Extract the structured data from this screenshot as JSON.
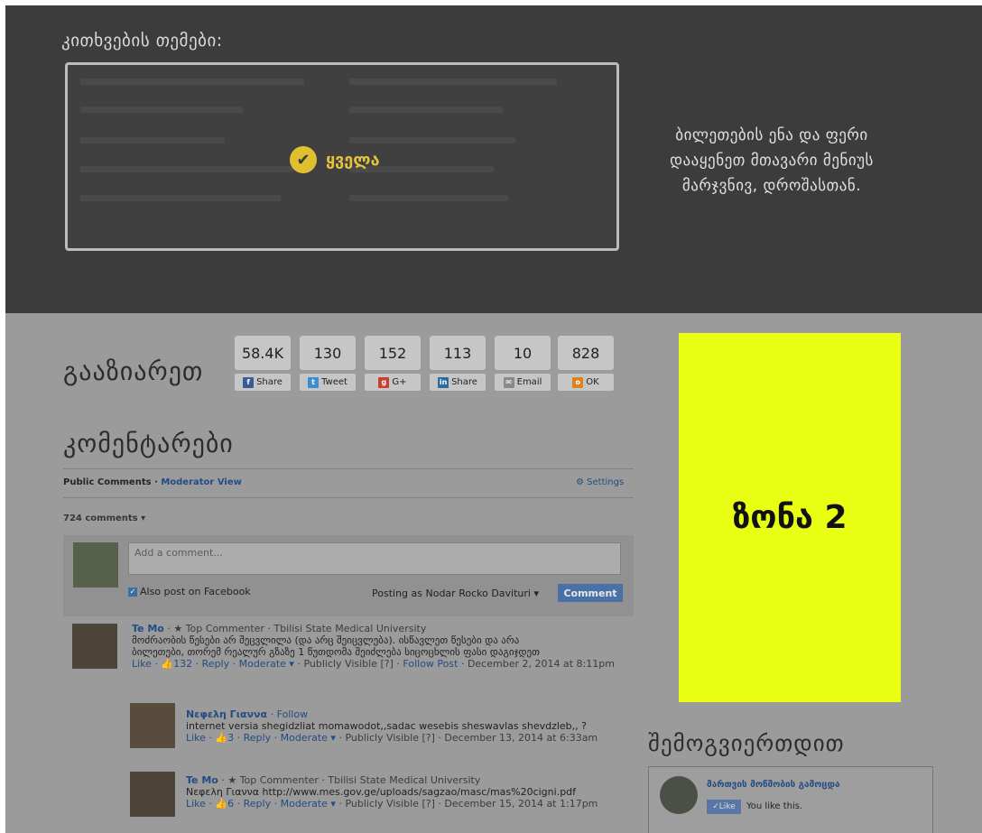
{
  "topics": {
    "title": "კითხვების თემები:",
    "all_label": "ყველა"
  },
  "note": "ბილეთების ენა და ფერი დააყენეთ მთავარი მენიუს მარჯვნივ, დროშასთან.",
  "share": {
    "heading": "გააზიარეთ",
    "items": [
      {
        "count": "58.4K",
        "label": "Share",
        "icon": "facebook-icon",
        "color": "#3b5b98",
        "glyph": "f"
      },
      {
        "count": "130",
        "label": "Tweet",
        "icon": "twitter-icon",
        "color": "#3a8fd4",
        "glyph": "t"
      },
      {
        "count": "152",
        "label": "G+",
        "icon": "google-plus-icon",
        "color": "#c84030",
        "glyph": "g"
      },
      {
        "count": "113",
        "label": "Share",
        "icon": "linkedin-icon",
        "color": "#2a6ba0",
        "glyph": "in"
      },
      {
        "count": "10",
        "label": "Email",
        "icon": "email-icon",
        "color": "#8a8a8a",
        "glyph": "✉"
      },
      {
        "count": "828",
        "label": "OK",
        "icon": "odnoklassniki-icon",
        "color": "#d88420",
        "glyph": "o"
      }
    ]
  },
  "comments": {
    "heading": "კომენტარები",
    "tab_public": "Public Comments",
    "tab_moderator": "Moderator View",
    "settings": "Settings",
    "count": "724 comments",
    "composer": {
      "placeholder": "Add a comment...",
      "also_post": "Also post on Facebook",
      "posting_as": "Posting as Nodar Rocko Davituri",
      "button": "Comment"
    },
    "list": [
      {
        "name": "Te Mo",
        "badge": "★ Top Commenter · Tbilisi State Medical University",
        "text1": "მოძრაობის წესები არ შეცვლილა (და არც შეიცვლება). ისწავლეთ წესები და არა",
        "text2": "ბილეთები, თორემ რეალურ გზაზე 1 წუთდომა შეიძლება სიცოცხლის ფასი დაგიჯდეთ",
        "likes": "132",
        "meta": "Publicly Visible",
        "extra": "Follow Post",
        "date": "December 2, 2014 at 8:11pm"
      },
      {
        "name": "Νεφελη Γιαννα",
        "badge": "Follow",
        "text1": "internet versia shegidzliat momawodot,,sadac wesebis sheswavlas shevdzleb,, ?",
        "likes": "3",
        "meta": "Publicly Visible",
        "date": "December 13, 2014 at 6:33am"
      },
      {
        "name": "Te Mo",
        "badge": "★ Top Commenter · Tbilisi State Medical University",
        "text1": "Νεφελη Γιαννα http://www.mes.gov.ge/uploads/sagzao/masc/mas%20cigni.pdf",
        "likes": "6",
        "meta": "Publicly Visible",
        "date": "December 15, 2014 at 1:17pm"
      }
    ]
  },
  "ad": {
    "label": "ზონა 2"
  },
  "contact": {
    "heading": "შემოგვიერთდით",
    "page_name": "მართვის მოწმობის გამოცდა",
    "like_label": "Like",
    "likes_text": "You like this."
  }
}
